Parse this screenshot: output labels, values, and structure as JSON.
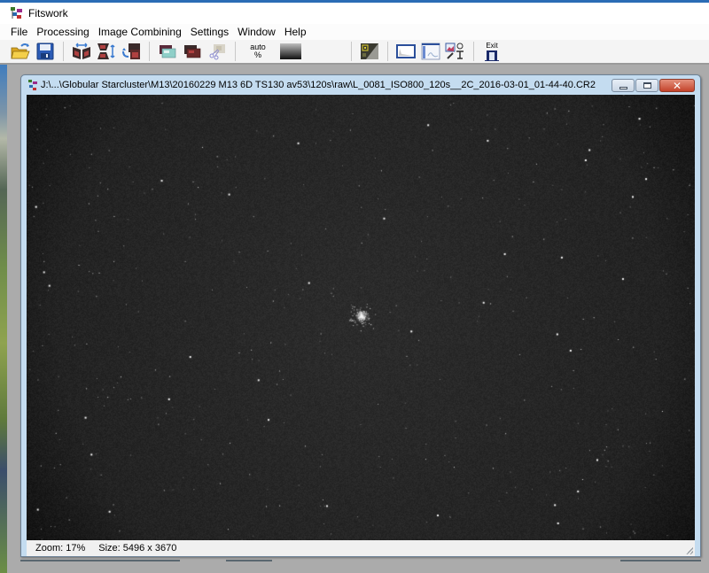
{
  "app": {
    "title": "Fitswork"
  },
  "menu": {
    "items": [
      {
        "label": "File"
      },
      {
        "label": "Processing"
      },
      {
        "label": "Image Combining"
      },
      {
        "label": "Settings"
      },
      {
        "label": "Window"
      },
      {
        "label": "Help"
      }
    ]
  },
  "toolbar": {
    "buttons": [
      {
        "name": "open-file",
        "icon": "open-folder-icon"
      },
      {
        "name": "save-file",
        "icon": "floppy-disk-icon"
      },
      {
        "name": "flip-horizontal",
        "icon": "flip-horizontal-icon"
      },
      {
        "name": "flip-vertical",
        "icon": "flip-vertical-icon"
      },
      {
        "name": "rotate",
        "icon": "rotate-images-icon"
      },
      {
        "name": "image-copy-1",
        "icon": "image-copy-icon"
      },
      {
        "name": "image-copy-2",
        "icon": "image-stack-icon"
      },
      {
        "name": "cut",
        "icon": "scissors-icon"
      },
      {
        "name": "auto-stretch",
        "icon": "auto-percent-icon"
      },
      {
        "name": "gradient",
        "icon": "gradient-icon"
      },
      {
        "name": "levels",
        "icon": "levels-icon"
      },
      {
        "name": "histogram",
        "icon": "histogram-icon"
      },
      {
        "name": "histogram-window",
        "icon": "histogram-window-icon"
      },
      {
        "name": "image-tools",
        "icon": "image-tools-icon"
      },
      {
        "name": "exit",
        "icon": "exit-door-icon"
      }
    ],
    "auto_label_top": "auto",
    "auto_label_bottom": "%",
    "exit_label": "Exit"
  },
  "child_window": {
    "title": "J:\\...\\Globular Starcluster\\M13\\20160229 M13 6D TS130 av53\\120s\\raw\\L_0081_ISO800_120s__2C_2016-03-01_01-44-40.CR2",
    "minimize_label": "minimize",
    "maximize_label": "maximize",
    "close_label": "✕"
  },
  "image": {
    "subject": "M13 globular star cluster, star field"
  },
  "status": {
    "zoom": "Zoom: 17%",
    "size": "Size: 5496 x 3670"
  },
  "colors": {
    "title_accent": "#2b6cb5",
    "close_button": "#c4432b",
    "window_frame": "#c4dcf0",
    "image_background": "#1e1e1e"
  }
}
